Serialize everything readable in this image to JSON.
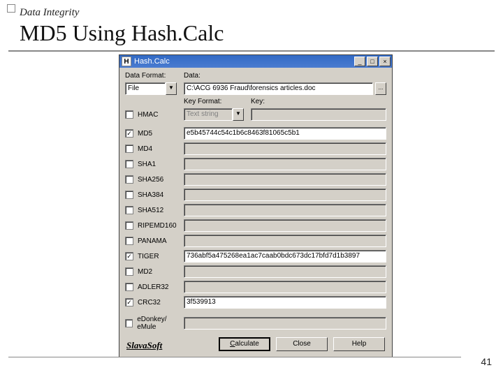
{
  "slide": {
    "kicker": "Data Integrity",
    "title": "MD5 Using Hash.Calc",
    "number": "41"
  },
  "window": {
    "title": "Hash.Calc",
    "icon_letter": "H",
    "labels": {
      "data_format": "Data Format:",
      "data": "Data:",
      "key_format": "Key Format:",
      "key": "Key:"
    },
    "data_format_value": "File",
    "data_value": "C:\\ACG 6936 Fraud\\forensics articles.doc",
    "key_format_value": "Text string",
    "key_value": "",
    "hmac_label": "HMAC",
    "hmac_checked": false,
    "hashes": [
      {
        "label": "MD5",
        "checked": true,
        "value": "e5b45744c54c1b6c8463f81065c5b1"
      },
      {
        "label": "MD4",
        "checked": false,
        "value": ""
      },
      {
        "label": "SHA1",
        "checked": false,
        "value": ""
      },
      {
        "label": "SHA256",
        "checked": false,
        "value": ""
      },
      {
        "label": "SHA384",
        "checked": false,
        "value": ""
      },
      {
        "label": "SHA512",
        "checked": false,
        "value": ""
      },
      {
        "label": "RIPEMD160",
        "checked": false,
        "value": ""
      },
      {
        "label": "PANAMA",
        "checked": false,
        "value": ""
      },
      {
        "label": "TIGER",
        "checked": true,
        "value": "736abf5a475268ea1ac7caab0bdc673dc17bfd7d1b3897"
      },
      {
        "label": "MD2",
        "checked": false,
        "value": ""
      },
      {
        "label": "ADLER32",
        "checked": false,
        "value": ""
      },
      {
        "label": "CRC32",
        "checked": true,
        "value": "3f539913"
      },
      {
        "label": "eDonkey/ eMule",
        "checked": false,
        "value": ""
      }
    ],
    "brand": "SlavaSoft",
    "buttons": {
      "calculate": "Calculate",
      "close": "Close",
      "help": "Help"
    }
  }
}
